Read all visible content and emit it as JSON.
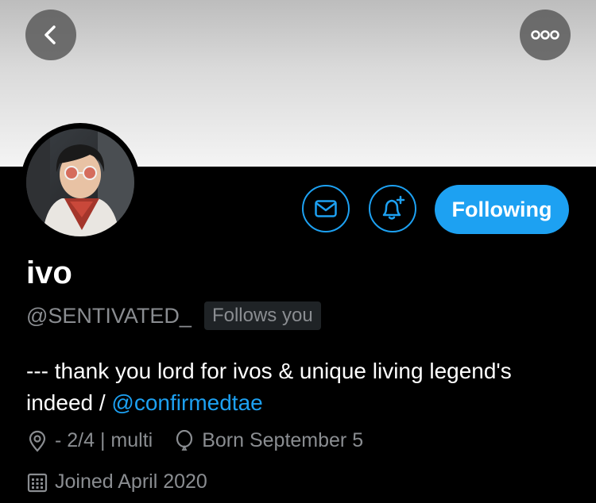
{
  "header": {
    "back_icon": "chevron-left-icon",
    "more_icon": "more-dots-icon"
  },
  "actions": {
    "message_icon": "mail-icon",
    "notify_icon": "bell-plus-icon",
    "follow_label": "Following"
  },
  "profile": {
    "name": "ivo",
    "handle": "@SENTIVATED_",
    "follows_you": "Follows you",
    "bio_text": "--- thank you lord for ivos & unique living legend's indeed / ",
    "bio_link": "@confirmedtae",
    "location": "- 2/4 | multi",
    "birthday": "Born September 5",
    "joined": "Joined April 2020"
  },
  "colors": {
    "accent": "#1da1f2",
    "muted": "#8a8d91",
    "background": "#000000"
  }
}
